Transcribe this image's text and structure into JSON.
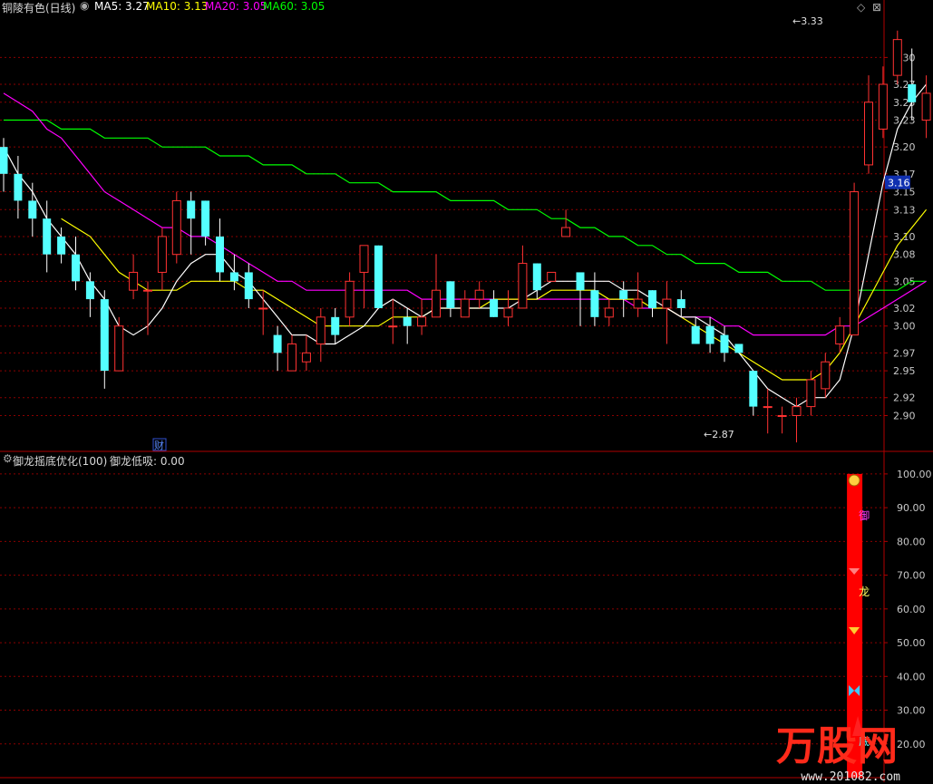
{
  "stock": {
    "title": "铜陵有色(日线)"
  },
  "ma_legend": [
    {
      "label": "MA5: 3.27",
      "color": "#ffffff"
    },
    {
      "label": "MA10: 3.13",
      "color": "#ffff00"
    },
    {
      "label": "MA20: 3.05",
      "color": "#ff00ff"
    },
    {
      "label": "MA60: 3.05",
      "color": "#00ff00"
    }
  ],
  "indicator": {
    "name": "御龙摇底优化(100)",
    "value_label": "御龙低吸: 0.00"
  },
  "price_badge": "3.16",
  "annotations": {
    "high": "3.33",
    "low": "2.87",
    "cai": "财"
  },
  "indicator_glyphs": [
    "御",
    "龙",
    "底"
  ],
  "watermark": {
    "brand": "万股网",
    "url": "www.201082.com"
  },
  "colors": {
    "up": "#ff3232",
    "down": "#54ffff",
    "grid": "#8b0000",
    "bar": "#ff0000"
  },
  "chart_data": [
    {
      "type": "candlestick",
      "y_ticks": [
        3.3,
        3.27,
        3.25,
        3.23,
        3.2,
        3.17,
        3.15,
        3.13,
        3.1,
        3.08,
        3.05,
        3.02,
        3.0,
        2.97,
        2.95,
        2.92,
        2.9
      ],
      "y_tick_labels": [
        "3.30",
        "3.27",
        "3.25",
        "3.23",
        "3.20",
        "3.17",
        "3.15",
        "3.13",
        "3.10",
        "3.08",
        "3.05",
        "3.02",
        "3.00",
        "2.97",
        "2.95",
        "2.92",
        "2.90"
      ],
      "ylim": [
        2.86,
        3.35
      ],
      "candles": [
        [
          3.2,
          3.17,
          3.21,
          3.15
        ],
        [
          3.17,
          3.14,
          3.19,
          3.12
        ],
        [
          3.14,
          3.12,
          3.16,
          3.1
        ],
        [
          3.12,
          3.08,
          3.14,
          3.06
        ],
        [
          3.1,
          3.08,
          3.11,
          3.07
        ],
        [
          3.08,
          3.05,
          3.1,
          3.04
        ],
        [
          3.05,
          3.03,
          3.06,
          3.01
        ],
        [
          3.03,
          2.95,
          3.04,
          2.93
        ],
        [
          2.95,
          3.0,
          3.01,
          2.95
        ],
        [
          3.04,
          3.06,
          3.08,
          3.03
        ],
        [
          3.04,
          3.04,
          3.05,
          2.99
        ],
        [
          3.06,
          3.1,
          3.11,
          3.04
        ],
        [
          3.08,
          3.14,
          3.15,
          3.07
        ],
        [
          3.14,
          3.12,
          3.15,
          3.08
        ],
        [
          3.14,
          3.1,
          3.14,
          3.09
        ],
        [
          3.1,
          3.06,
          3.12,
          3.05
        ],
        [
          3.06,
          3.05,
          3.08,
          3.04
        ],
        [
          3.06,
          3.03,
          3.07,
          3.02
        ],
        [
          3.02,
          3.02,
          3.04,
          2.99
        ],
        [
          2.99,
          2.97,
          3.0,
          2.95
        ],
        [
          2.95,
          2.98,
          2.99,
          2.95
        ],
        [
          2.96,
          2.97,
          2.99,
          2.95
        ],
        [
          2.98,
          3.01,
          3.02,
          2.96
        ],
        [
          3.01,
          2.99,
          3.02,
          2.98
        ],
        [
          3.01,
          3.05,
          3.06,
          3.0
        ],
        [
          3.06,
          3.09,
          3.09,
          3.02
        ],
        [
          3.09,
          3.02,
          3.09,
          3.02
        ],
        [
          3.0,
          3.0,
          3.03,
          2.98
        ],
        [
          3.01,
          3.0,
          3.02,
          2.98
        ],
        [
          3.0,
          3.01,
          3.03,
          2.99
        ],
        [
          3.01,
          3.04,
          3.08,
          3.01
        ],
        [
          3.05,
          3.02,
          3.05,
          3.01
        ],
        [
          3.01,
          3.03,
          3.04,
          3.01
        ],
        [
          3.03,
          3.04,
          3.05,
          3.02
        ],
        [
          3.03,
          3.01,
          3.04,
          3.01
        ],
        [
          3.01,
          3.02,
          3.04,
          3.0
        ],
        [
          3.02,
          3.07,
          3.09,
          3.02
        ],
        [
          3.07,
          3.04,
          3.07,
          3.03
        ],
        [
          3.05,
          3.06,
          3.06,
          3.05
        ],
        [
          3.1,
          3.11,
          3.13,
          3.1
        ],
        [
          3.06,
          3.04,
          3.06,
          3.0
        ],
        [
          3.04,
          3.01,
          3.06,
          3.0
        ],
        [
          3.01,
          3.02,
          3.03,
          3.0
        ],
        [
          3.04,
          3.03,
          3.05,
          3.01
        ],
        [
          3.02,
          3.03,
          3.06,
          3.01
        ],
        [
          3.04,
          3.02,
          3.04,
          3.01
        ],
        [
          3.02,
          3.03,
          3.05,
          2.98
        ],
        [
          3.03,
          3.02,
          3.04,
          3.01
        ],
        [
          3.0,
          2.98,
          3.01,
          2.98
        ],
        [
          3.0,
          2.98,
          3.01,
          2.97
        ],
        [
          2.99,
          2.97,
          3.0,
          2.96
        ],
        [
          2.98,
          2.97,
          2.98,
          2.97
        ],
        [
          2.95,
          2.91,
          2.95,
          2.9
        ],
        [
          2.91,
          2.91,
          2.93,
          2.88
        ],
        [
          2.9,
          2.9,
          2.91,
          2.88
        ],
        [
          2.9,
          2.91,
          2.92,
          2.87
        ],
        [
          2.91,
          2.94,
          2.95,
          2.9
        ],
        [
          2.93,
          2.96,
          2.97,
          2.92
        ],
        [
          2.98,
          3.0,
          3.01,
          2.97
        ],
        [
          2.99,
          3.15,
          3.16,
          2.99
        ],
        [
          3.18,
          3.25,
          3.28,
          3.17
        ],
        [
          3.22,
          3.27,
          3.29,
          3.21
        ],
        [
          3.28,
          3.32,
          3.33,
          3.27
        ],
        [
          3.27,
          3.25,
          3.31,
          3.23
        ],
        [
          3.23,
          3.26,
          3.28,
          3.21
        ]
      ],
      "ma5": [
        3.2,
        3.17,
        3.15,
        3.12,
        3.1,
        3.08,
        3.05,
        3.03,
        3.0,
        2.99,
        3.0,
        3.02,
        3.05,
        3.07,
        3.08,
        3.08,
        3.06,
        3.05,
        3.03,
        3.01,
        2.99,
        2.99,
        2.98,
        2.98,
        2.99,
        3.0,
        3.02,
        3.03,
        3.02,
        3.01,
        3.02,
        3.02,
        3.02,
        3.02,
        3.02,
        3.02,
        3.03,
        3.04,
        3.05,
        3.05,
        3.05,
        3.05,
        3.05,
        3.04,
        3.04,
        3.03,
        3.02,
        3.01,
        3.01,
        3.0,
        2.99,
        2.97,
        2.95,
        2.93,
        2.92,
        2.91,
        2.92,
        2.92,
        2.94,
        3.0,
        3.08,
        3.16,
        3.22,
        3.25,
        3.27
      ],
      "ma10": [
        null,
        null,
        null,
        null,
        3.12,
        3.11,
        3.1,
        3.08,
        3.06,
        3.05,
        3.04,
        3.04,
        3.04,
        3.05,
        3.05,
        3.05,
        3.05,
        3.04,
        3.04,
        3.03,
        3.02,
        3.01,
        3.0,
        3.0,
        3.0,
        3.0,
        3.0,
        3.01,
        3.01,
        3.01,
        3.02,
        3.02,
        3.02,
        3.02,
        3.03,
        3.03,
        3.03,
        3.03,
        3.04,
        3.04,
        3.04,
        3.04,
        3.03,
        3.03,
        3.03,
        3.02,
        3.02,
        3.01,
        3.0,
        2.99,
        2.98,
        2.97,
        2.96,
        2.95,
        2.94,
        2.94,
        2.94,
        2.95,
        2.97,
        3.0,
        3.03,
        3.06,
        3.09,
        3.11,
        3.13
      ],
      "ma20": [
        3.26,
        3.25,
        3.24,
        3.22,
        3.21,
        3.19,
        3.17,
        3.15,
        3.14,
        3.13,
        3.12,
        3.11,
        3.11,
        3.1,
        3.1,
        3.09,
        3.08,
        3.07,
        3.06,
        3.05,
        3.05,
        3.04,
        3.04,
        3.04,
        3.04,
        3.04,
        3.04,
        3.04,
        3.04,
        3.03,
        3.03,
        3.03,
        3.03,
        3.03,
        3.03,
        3.03,
        3.03,
        3.03,
        3.03,
        3.03,
        3.03,
        3.03,
        3.03,
        3.03,
        3.02,
        3.02,
        3.02,
        3.01,
        3.01,
        3.01,
        3.0,
        3.0,
        2.99,
        2.99,
        2.99,
        2.99,
        2.99,
        2.99,
        3.0,
        3.0,
        3.01,
        3.02,
        3.03,
        3.04,
        3.05
      ],
      "ma60": [
        3.23,
        3.23,
        3.23,
        3.23,
        3.22,
        3.22,
        3.22,
        3.21,
        3.21,
        3.21,
        3.21,
        3.2,
        3.2,
        3.2,
        3.2,
        3.19,
        3.19,
        3.19,
        3.18,
        3.18,
        3.18,
        3.17,
        3.17,
        3.17,
        3.16,
        3.16,
        3.16,
        3.15,
        3.15,
        3.15,
        3.15,
        3.14,
        3.14,
        3.14,
        3.14,
        3.13,
        3.13,
        3.13,
        3.12,
        3.12,
        3.11,
        3.11,
        3.1,
        3.1,
        3.09,
        3.09,
        3.08,
        3.08,
        3.07,
        3.07,
        3.07,
        3.06,
        3.06,
        3.06,
        3.05,
        3.05,
        3.05,
        3.04,
        3.04,
        3.04,
        3.04,
        3.04,
        3.04,
        3.05,
        3.05
      ]
    },
    {
      "type": "bar",
      "y_ticks": [
        100,
        90,
        80,
        70,
        60,
        50,
        40,
        30,
        20
      ],
      "y_tick_labels": [
        "100.00",
        "90.00",
        "80.00",
        "70.00",
        "60.00",
        "50.00",
        "40.00",
        "30.00",
        "20.00"
      ],
      "ylim": [
        10,
        104
      ],
      "bar": {
        "index": 59,
        "value": 100
      }
    }
  ]
}
